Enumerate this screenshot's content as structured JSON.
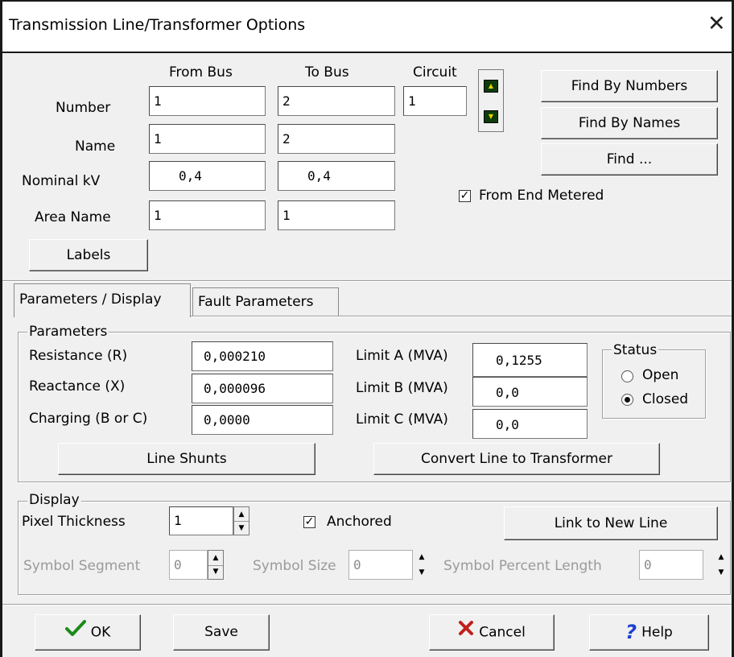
{
  "window": {
    "title": "Transmission Line/Transformer Options",
    "close_glyph": "✕"
  },
  "header": {
    "col_from_bus": "From Bus",
    "col_to_bus": "To Bus",
    "col_circuit": "Circuit",
    "row_number": "Number",
    "row_name": "Name",
    "row_nominal_kv": "Nominal kV",
    "row_area_name": "Area Name",
    "number_from": "1",
    "number_to": "2",
    "circuit": "1",
    "name_from": "1",
    "name_to": "2",
    "kv_from": "0,4",
    "kv_to": "0,4",
    "area_from": "1",
    "area_to": "1",
    "labels_button": "Labels",
    "find_by_numbers": "Find By Numbers",
    "find_by_names": "Find By Names",
    "find": "Find ...",
    "from_end_metered": "From End Metered",
    "from_end_metered_checked": true
  },
  "tabs": [
    {
      "label": "Parameters / Display",
      "active": true
    },
    {
      "label": "Fault Parameters",
      "active": false
    }
  ],
  "parameters": {
    "group_title": "Parameters",
    "resistance_label": "Resistance (R)",
    "resistance_value": "0,000210",
    "reactance_label": "Reactance (X)",
    "reactance_value": "0,000096",
    "charging_label": "Charging (B or C)",
    "charging_value": "0,0000",
    "limit_a_label": "Limit A (MVA)",
    "limit_a_value": "0,1255",
    "limit_b_label": "Limit B (MVA)",
    "limit_b_value": "0,0",
    "limit_c_label": "Limit C (MVA)",
    "limit_c_value": "0,0",
    "status_title": "Status",
    "status_open": "Open",
    "status_closed": "Closed",
    "status_selected": "Closed",
    "line_shunts": "Line Shunts",
    "convert_button": "Convert Line to Transformer"
  },
  "display": {
    "group_title": "Display",
    "pixel_thickness_label": "Pixel Thickness",
    "pixel_thickness_value": "1",
    "anchored_label": "Anchored",
    "anchored_checked": true,
    "link_button": "Link to New Line",
    "symbol_segment_label": "Symbol Segment",
    "symbol_segment_value": "0",
    "symbol_size_label": "Symbol Size",
    "symbol_size_value": "0",
    "symbol_percent_label": "Symbol Percent Length",
    "symbol_percent_value": "0"
  },
  "footer": {
    "ok": "OK",
    "save": "Save",
    "cancel": "Cancel",
    "help": "Help",
    "ok_icon_color": "#1a8a1a",
    "cancel_icon_color": "#c0201a",
    "help_icon_color": "#1c3fd0"
  }
}
